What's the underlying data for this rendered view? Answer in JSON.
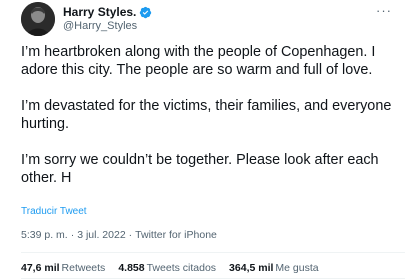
{
  "author": {
    "display_name": "Harry Styles.",
    "handle": "@Harry_Styles",
    "verified": true,
    "verified_color": "#1d9bf0"
  },
  "tweet": {
    "paragraphs": [
      "I’m heartbroken along with the people of Copenhagen. I adore this city. The people are so warm and full of love.",
      "I’m devastated for the victims, their families, and everyone hurting.",
      "I’m sorry we couldn’t be together. Please look after each other. H"
    ],
    "translate_label": "Traducir Tweet"
  },
  "meta": {
    "time": "5:39 p. m.",
    "separator": "·",
    "date": "3 jul. 2022",
    "source": "Twitter for iPhone"
  },
  "stats": {
    "retweets_count": "47,6 mil",
    "retweets_label": "Retweets",
    "quotes_count": "4.858",
    "quotes_label": "Tweets citados",
    "likes_count": "364,5 mil",
    "likes_label": "Me gusta"
  },
  "icons": {
    "avatar": "profile-photo",
    "verified": "verified-badge-icon",
    "more": "more-options-icon"
  },
  "colors": {
    "accent": "#1d9bf0",
    "text": "#0f1419",
    "secondary": "#536471"
  }
}
